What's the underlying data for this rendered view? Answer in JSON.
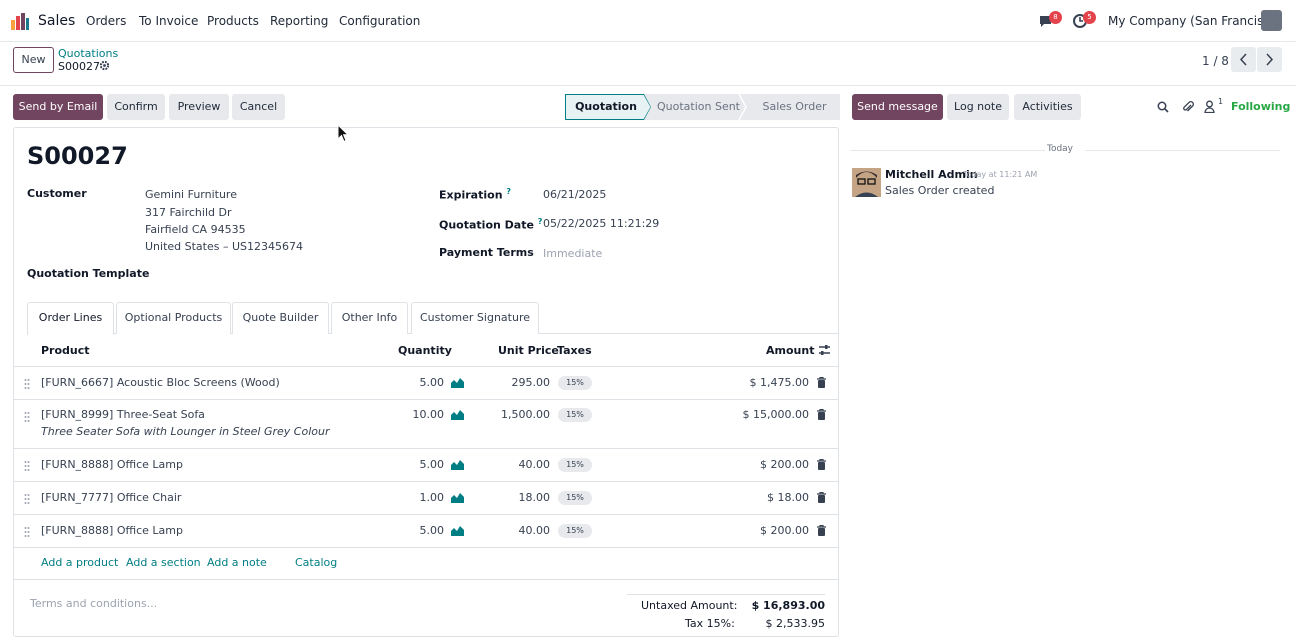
{
  "topbar": {
    "app_name": "Sales",
    "menu": [
      "Orders",
      "To Invoice",
      "Products",
      "Reporting",
      "Configuration"
    ],
    "messages_badge": "8",
    "activities_badge": "5",
    "company": "My Company (San Francisco)"
  },
  "control_panel": {
    "new_label": "New",
    "breadcrumb_parent": "Quotations",
    "breadcrumb_current": "S00027",
    "pager": "1 / 8"
  },
  "actions": {
    "send_email": "Send by Email",
    "confirm": "Confirm",
    "preview": "Preview",
    "cancel": "Cancel"
  },
  "status_stages": [
    "Quotation",
    "Quotation Sent",
    "Sales Order"
  ],
  "record": {
    "name": "S00027",
    "customer_label": "Customer",
    "customer_lines": [
      "Gemini Furniture",
      "317 Fairchild Dr",
      "Fairfield CA 94535",
      "United States – US12345674"
    ],
    "quotation_template_label": "Quotation Template",
    "expiration_label": "Expiration",
    "expiration_value": "06/21/2025",
    "quotation_date_label": "Quotation Date",
    "quotation_date_value": "05/22/2025 11:21:29",
    "payment_terms_label": "Payment Terms",
    "payment_terms_value": "Immediate",
    "help_mark": "?"
  },
  "tabs": [
    "Order Lines",
    "Optional Products",
    "Quote Builder",
    "Other Info",
    "Customer Signature"
  ],
  "table": {
    "headers": {
      "product": "Product",
      "quantity": "Quantity",
      "unit_price": "Unit Price",
      "taxes": "Taxes",
      "amount": "Amount"
    },
    "rows": [
      {
        "product": "[FURN_6667] Acoustic Bloc Screens (Wood)",
        "description": "",
        "quantity": "5.00",
        "unit_price": "295.00",
        "tax": "15%",
        "amount": "$ 1,475.00"
      },
      {
        "product": "[FURN_8999] Three-Seat Sofa",
        "description": "Three Seater Sofa with Lounger in Steel Grey Colour",
        "quantity": "10.00",
        "unit_price": "1,500.00",
        "tax": "15%",
        "amount": "$ 15,000.00"
      },
      {
        "product": "[FURN_8888] Office Lamp",
        "description": "",
        "quantity": "5.00",
        "unit_price": "40.00",
        "tax": "15%",
        "amount": "$ 200.00"
      },
      {
        "product": "[FURN_7777] Office Chair",
        "description": "",
        "quantity": "1.00",
        "unit_price": "18.00",
        "tax": "15%",
        "amount": "$ 18.00"
      },
      {
        "product": "[FURN_8888] Office Lamp",
        "description": "",
        "quantity": "5.00",
        "unit_price": "40.00",
        "tax": "15%",
        "amount": "$ 200.00"
      }
    ],
    "add_links": [
      "Add a product",
      "Add a section",
      "Add a note",
      "Catalog"
    ]
  },
  "footer": {
    "terms_placeholder": "Terms and conditions...",
    "untaxed_label": "Untaxed Amount:",
    "untaxed_value": "$ 16,893.00",
    "tax_label": "Tax 15%:",
    "tax_value": "$ 2,533.95"
  },
  "chatter": {
    "send_message": "Send message",
    "log_note": "Log note",
    "activities": "Activities",
    "followers_count": "1",
    "following": "Following",
    "today": "Today",
    "author": "Mitchell Admin",
    "time": "Today at 11:21 AM",
    "body": "Sales Order created"
  },
  "colors": {
    "brand": "#71455f",
    "link": "#017e84",
    "badge": "#e3434b",
    "following": "#28a745"
  }
}
